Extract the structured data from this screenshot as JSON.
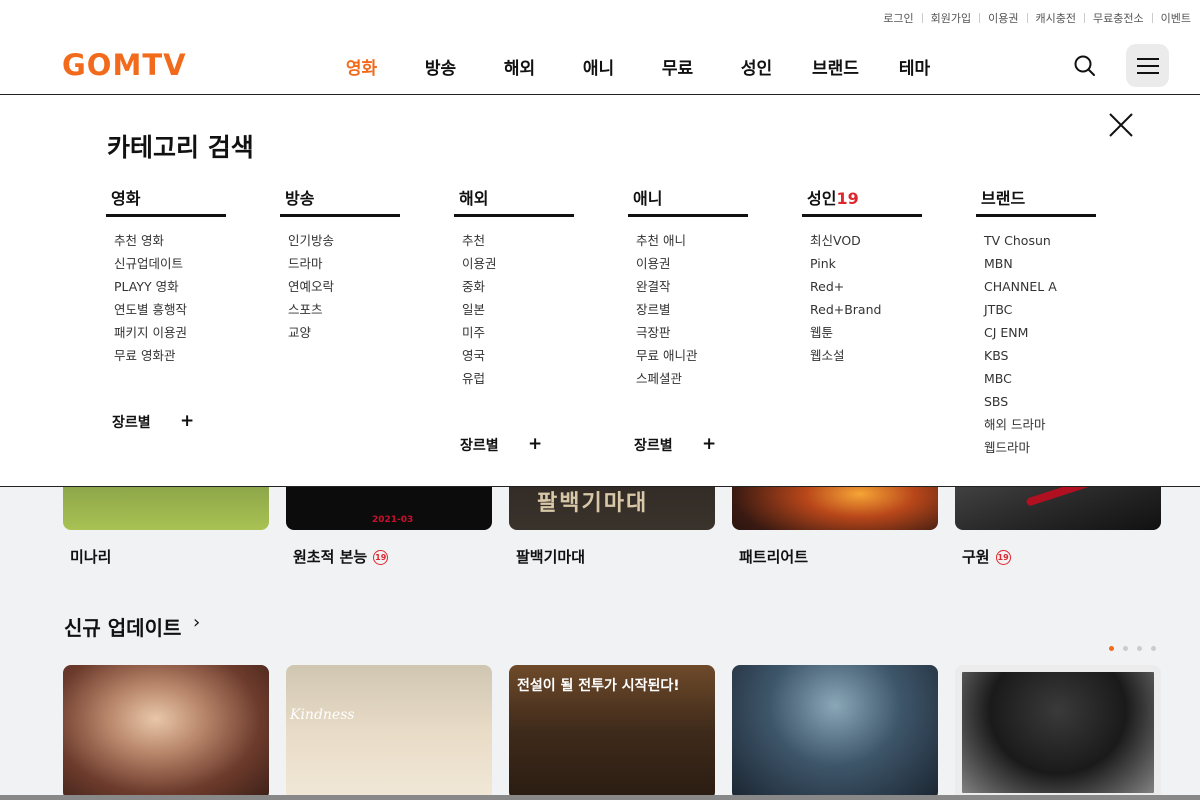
{
  "util_links": [
    "로그인",
    "회원가입",
    "이용권",
    "캐시충전",
    "무료충전소",
    "이벤트"
  ],
  "logo_text": "GOMTV",
  "nav": [
    "영화",
    "방송",
    "해외",
    "애니",
    "무료",
    "성인",
    "브랜드",
    "테마"
  ],
  "active_nav": "영화",
  "colors": {
    "accent": "#f26b1d",
    "adult": "#e0262d"
  },
  "overlay": {
    "title": "카테고리 검색",
    "columns": [
      {
        "head": "영화",
        "items": [
          "추천 영화",
          "신규업데이트",
          "PLAYY 영화",
          "연도별 흥행작",
          "패키지 이용권",
          "무료 영화관"
        ],
        "genre": "장르별"
      },
      {
        "head": "방송",
        "items": [
          "인기방송",
          "드라마",
          "연예오락",
          "스포츠",
          "교양"
        ]
      },
      {
        "head": "해외",
        "items": [
          "추천",
          "이용권",
          "중화",
          "일본",
          "미주",
          "영국",
          "유럽"
        ],
        "genre": "장르별"
      },
      {
        "head": "애니",
        "items": [
          "추천 애니",
          "이용권",
          "완결작",
          "장르별",
          "극장판",
          "무료 애니관",
          "스페셜관"
        ],
        "genre": "장르별"
      },
      {
        "head": "성인",
        "head_suffix": "19",
        "items": [
          "최신VOD",
          "Pink",
          "Red+",
          "Red+Brand",
          "웹툰",
          "웹소설"
        ]
      },
      {
        "head": "브랜드",
        "items": [
          "TV Chosun",
          "MBN",
          "CHANNEL A",
          "JTBC",
          "CJ ENM",
          "KBS",
          "MBC",
          "SBS",
          "해외 드라마",
          "웹드라마"
        ]
      }
    ]
  },
  "top_row": {
    "titles": [
      {
        "text": "미나리",
        "adult": false
      },
      {
        "text": "원초적 본능",
        "adult": true
      },
      {
        "text": "팔백기마대",
        "adult": false
      },
      {
        "text": "패트리어트",
        "adult": false
      },
      {
        "text": "구원",
        "adult": true
      }
    ],
    "age_badge": "19",
    "poster_texts": {
      "p2": "2021-03",
      "p3": "팔백기마대"
    }
  },
  "section": {
    "title": "신규 업데이트",
    "arrow": "›"
  },
  "bottom_row": {
    "poster_text": "전설이 될 전투가 시작된다!",
    "poster_text2": "Kindness"
  }
}
